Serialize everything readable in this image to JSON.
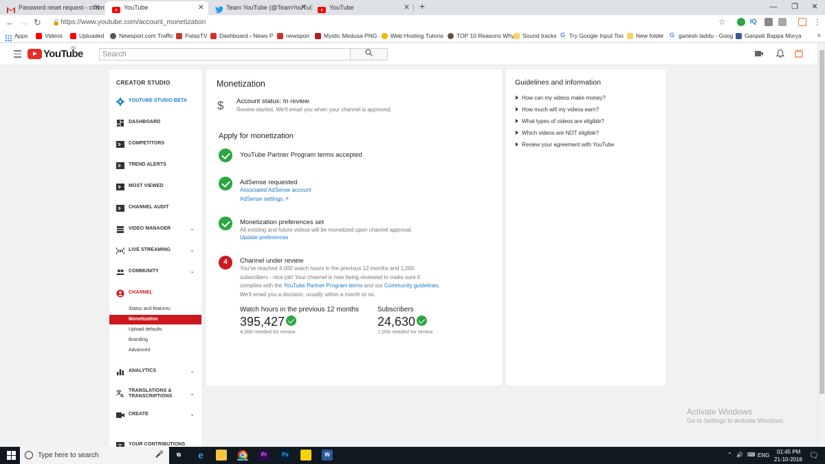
{
  "browser": {
    "tabs": [
      {
        "title": "Password reset request - cthem",
        "icon": "gmail-icon",
        "color": "#d93025"
      },
      {
        "title": "YouTube",
        "icon": "youtube-icon",
        "color": "#ff0000",
        "active": true
      },
      {
        "title": "Team YouTube (@TeamYouTube)",
        "icon": "twitter-icon",
        "color": "#1da1f2"
      },
      {
        "title": "YouTube",
        "icon": "youtube-icon",
        "color": "#ff0000"
      }
    ],
    "new_tab": "+",
    "url": "https://www.youtube.com/account_monetization",
    "extensions": [
      "IQ"
    ],
    "bookmarks": [
      {
        "label": "Apps",
        "color": "#4285f4"
      },
      {
        "label": "Videos",
        "color": "#ff0000"
      },
      {
        "label": "Uploaded",
        "color": "#ff0000"
      },
      {
        "label": "Newspori.com Traffic",
        "color": "#555555"
      },
      {
        "label": "PatasTV",
        "color": "#c0392b"
      },
      {
        "label": "Dashboard ‹ News P",
        "color": "#d93025"
      },
      {
        "label": "newspori",
        "color": "#d93025"
      },
      {
        "label": "Mystic Medusa PNG",
        "color": "#b71c1c"
      },
      {
        "label": "Web Hosting Tutoria",
        "color": "#f4b400"
      },
      {
        "label": "TOP 10 Reasons Why",
        "color": "#6d4c41"
      },
      {
        "label": "Sound tracks",
        "color": "#f6d365"
      },
      {
        "label": "Try Google Input Too",
        "color": "#4285f4"
      },
      {
        "label": "New folder",
        "color": "#f6d365"
      },
      {
        "label": "ganesh laddu - Goog",
        "color": "#4285f4"
      },
      {
        "label": "Ganpati Bappa Morya",
        "color": "#3b5998"
      }
    ],
    "bookmarks_more": "»"
  },
  "masthead": {
    "logo_text": "YouTube",
    "country_code": "IN",
    "search_placeholder": "Search",
    "search_icon": "🔍"
  },
  "sidebar": {
    "heading": "CREATOR STUDIO",
    "items": [
      {
        "label": "YOUTUBE STUDIO BETA",
        "icon": "gear-icon",
        "color": "#167ac6"
      },
      {
        "label": "DASHBOARD",
        "icon": "dashboard-icon"
      },
      {
        "label": "COMPETITORS",
        "icon": "tubebuddy-icon"
      },
      {
        "label": "TREND ALERTS",
        "icon": "tubebuddy-icon"
      },
      {
        "label": "MOST VIEWED",
        "icon": "tubebuddy-icon"
      },
      {
        "label": "CHANNEL AUDIT",
        "icon": "tubebuddy-icon"
      },
      {
        "label": "VIDEO MANAGER",
        "icon": "video-manager-icon",
        "chevron": true
      },
      {
        "label": "LIVE STREAMING",
        "icon": "live-icon",
        "chevron": true
      },
      {
        "label": "COMMUNITY",
        "icon": "community-icon",
        "chevron": true
      },
      {
        "label": "CHANNEL",
        "icon": "channel-icon",
        "color": "#cc181e"
      }
    ],
    "channel_sub": [
      "Status and features",
      "Monetization",
      "Upload defaults",
      "Branding",
      "Advanced"
    ],
    "items_after": [
      {
        "label": "ANALYTICS",
        "icon": "analytics-icon",
        "chevron": true
      },
      {
        "label": "TRANSLATIONS & TRANSCRIPTIONS",
        "icon": "translate-icon",
        "chevron": true
      },
      {
        "label": "CREATE",
        "icon": "create-icon",
        "chevron": true
      },
      {
        "label": "YOUR CONTRIBUTIONS",
        "icon": "contributions-icon"
      }
    ],
    "chevron": "⌄"
  },
  "main": {
    "title": "Monetization",
    "currency_symbol": "$",
    "account_status": "Account status: In review",
    "account_desc": "Review started. We'll email you when your channel is approved.",
    "apply_title": "Apply for monetization",
    "steps": [
      {
        "title": "YouTube Partner Program terms accepted"
      },
      {
        "title": "AdSense requested",
        "link1": "Associated AdSense account",
        "link2": "AdSense settings ↗"
      },
      {
        "title": "Monetization preferences set",
        "desc": "All existing and future videos will be monetized upon channel approval.",
        "link1": "Update preferences"
      },
      {
        "number": "4",
        "title": "Channel under review",
        "desc_lines": [
          "You've reached 4,000 watch hours in the previous 12 months and 1,000",
          "subscribers - nice job! Your channel is now being reviewed to make sure it",
          "complies with the ",
          "YouTube Partner Program terms",
          " and our ",
          "Community guidelines",
          ".",
          "We'll email you a decision, usually within a month or so."
        ]
      }
    ],
    "stats": [
      {
        "label": "Watch hours in the previous 12 months",
        "value": "395,427",
        "note": "4,000 needed for review"
      },
      {
        "label": "Subscribers",
        "value": "24,630",
        "note": "1,000 needed for review"
      }
    ]
  },
  "guidelines": {
    "title": "Guidelines and information",
    "items": [
      "How can my videos make money?",
      "How much will my videos earn?",
      "What types of videos are eligible?",
      "Which videos are NOT eligible?",
      "Review your agreement with YouTube"
    ]
  },
  "watermark": {
    "title": "Activate Windows",
    "subtitle": "Go to Settings to activate Windows."
  },
  "taskbar": {
    "search_text": "Type here to search",
    "lang": "ENG",
    "time": "01:45 PM",
    "date": "21-10-2018"
  },
  "colors": {
    "brand_red": "#cc181e",
    "link_blue": "#167ac6",
    "success_green": "#2ba640"
  }
}
